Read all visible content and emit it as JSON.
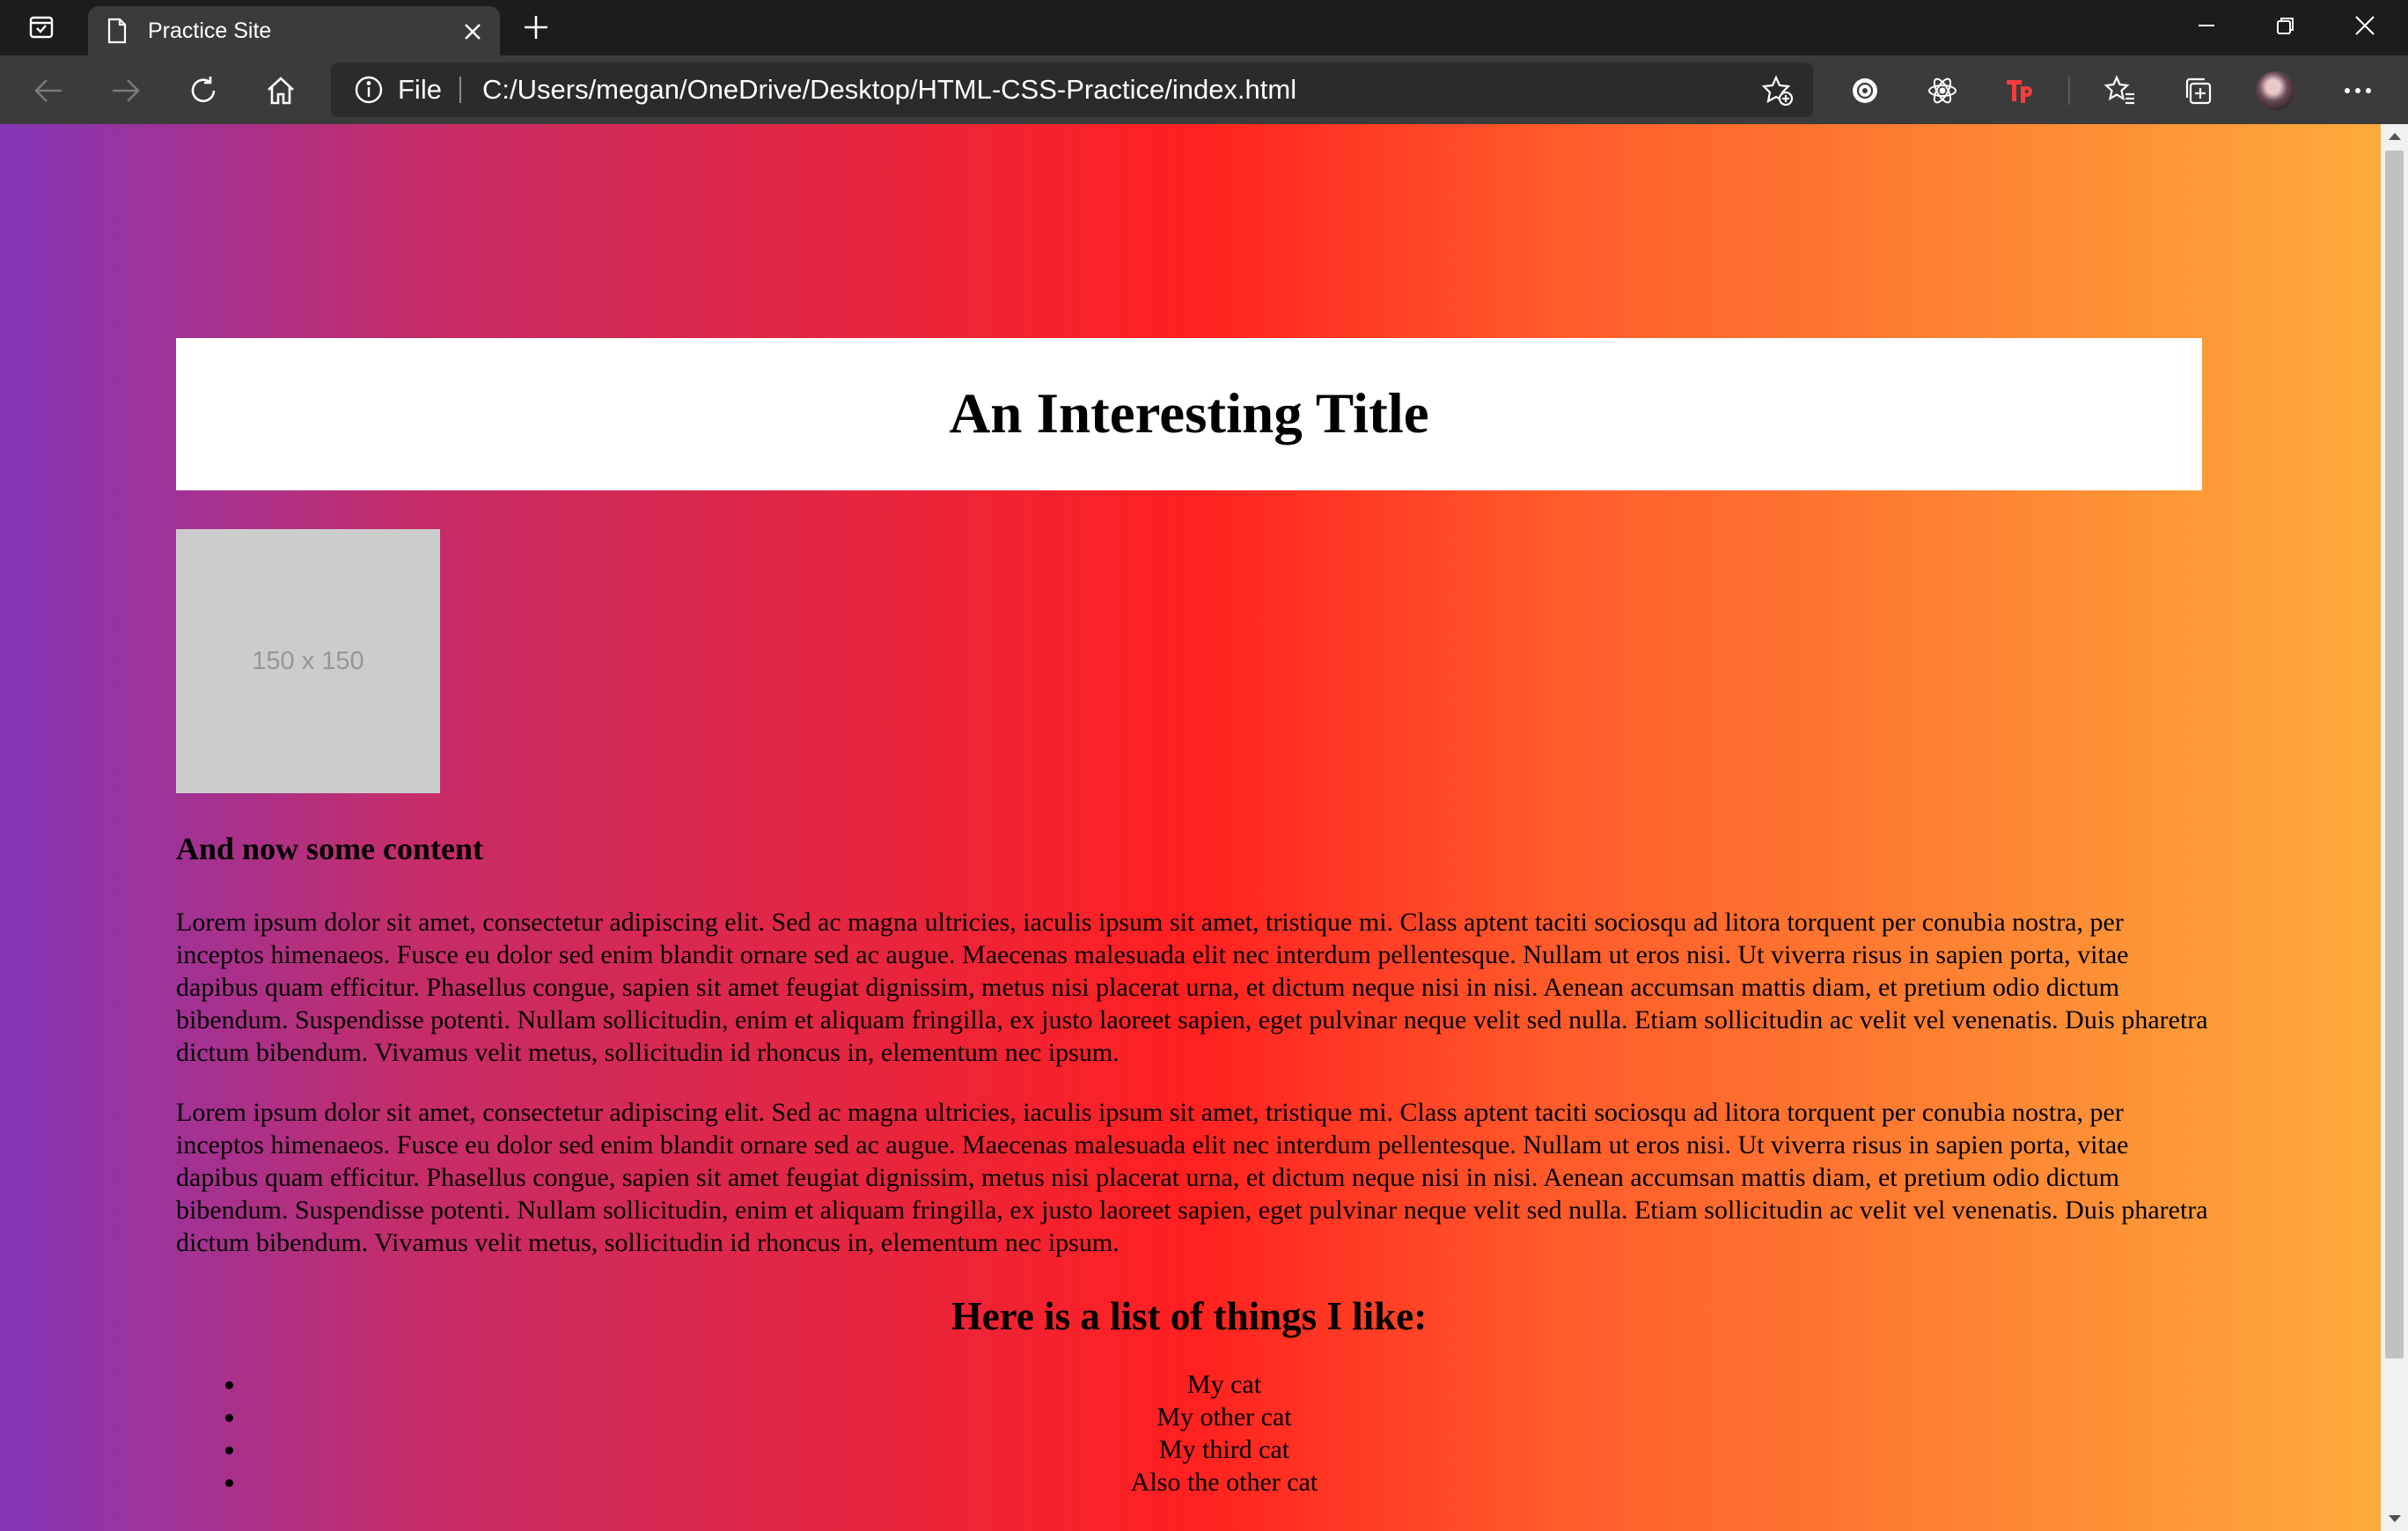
{
  "browser": {
    "tab": {
      "title": "Practice Site",
      "favicon": "document-icon"
    },
    "address": {
      "scheme": "File",
      "url": "C:/Users/megan/OneDrive/Desktop/HTML-CSS-Practice/index.html"
    },
    "toolbar_icons": [
      "back-icon",
      "forward-icon",
      "refresh-icon",
      "home-icon",
      "add-favorite-icon",
      "extension-icon",
      "react-devtools-icon",
      "tp-extension-icon",
      "favorites-icon",
      "collections-icon",
      "profile-avatar",
      "more-icon"
    ]
  },
  "page": {
    "title": "An Interesting Title",
    "image_placeholder": "150 x 150",
    "content_heading": "And now some content",
    "paragraphs": [
      "Lorem ipsum dolor sit amet, consectetur adipiscing elit. Sed ac magna ultricies, iaculis ipsum sit amet, tristique mi. Class aptent taciti sociosqu ad litora torquent per conubia nostra, per inceptos himenaeos. Fusce eu dolor sed enim blandit ornare sed ac augue. Maecenas malesuada elit nec interdum pellentesque. Nullam ut eros nisi. Ut viverra risus in sapien porta, vitae dapibus quam efficitur. Phasellus congue, sapien sit amet feugiat dignissim, metus nisi placerat urna, et dictum neque nisi in nisi. Aenean accumsan mattis diam, et pretium odio dictum bibendum. Suspendisse potenti. Nullam sollicitudin, enim et aliquam fringilla, ex justo laoreet sapien, eget pulvinar neque velit sed nulla. Etiam sollicitudin ac velit vel venenatis. Duis pharetra dictum bibendum. Vivamus velit metus, sollicitudin id rhoncus in, elementum nec ipsum.",
      "Lorem ipsum dolor sit amet, consectetur adipiscing elit. Sed ac magna ultricies, iaculis ipsum sit amet, tristique mi. Class aptent taciti sociosqu ad litora torquent per conubia nostra, per inceptos himenaeos. Fusce eu dolor sed enim blandit ornare sed ac augue. Maecenas malesuada elit nec interdum pellentesque. Nullam ut eros nisi. Ut viverra risus in sapien porta, vitae dapibus quam efficitur. Phasellus congue, sapien sit amet feugiat dignissim, metus nisi placerat urna, et dictum neque nisi in nisi. Aenean accumsan mattis diam, et pretium odio dictum bibendum. Suspendisse potenti. Nullam sollicitudin, enim et aliquam fringilla, ex justo laoreet sapien, eget pulvinar neque velit sed nulla. Etiam sollicitudin ac velit vel venenatis. Duis pharetra dictum bibendum. Vivamus velit metus, sollicitudin id rhoncus in, elementum nec ipsum."
    ],
    "list_heading": "Here is a list of things I like:",
    "likes": [
      "My cat",
      "My other cat",
      "My third cat",
      "Also the other cat"
    ]
  },
  "colors": {
    "gradient": [
      "#8436b8",
      "#c42d6a",
      "#ff2020",
      "#ff5a2a",
      "#fdab3c"
    ],
    "chrome_dark": "#1c1c1c",
    "toolbar": "#3b3b3b",
    "placeholder_bg": "#cccccc"
  }
}
